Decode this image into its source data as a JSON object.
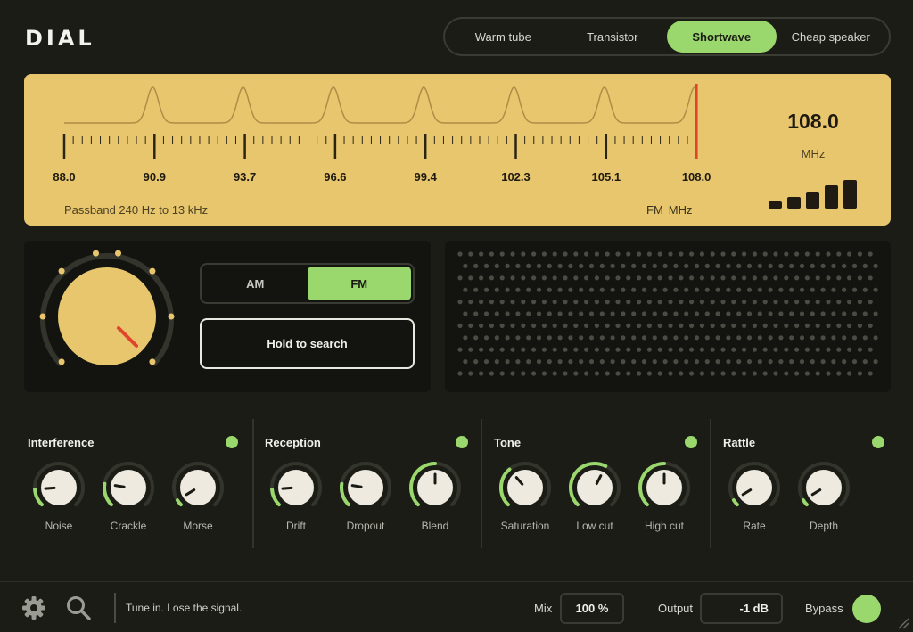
{
  "app": {
    "title": "DIAL"
  },
  "presets": {
    "items": [
      "Warm tube",
      "Transistor",
      "Shortwave",
      "Cheap speaker"
    ],
    "active_index": 2
  },
  "tuner": {
    "scale_labels": [
      "88.0",
      "90.9",
      "93.7",
      "96.6",
      "99.4",
      "102.3",
      "105.1",
      "108.0"
    ],
    "current_frequency": "108.0",
    "unit": "MHz",
    "passband_text": "Passband 240 Hz to 13 kHz",
    "band": "FM",
    "band_unit": "MHz",
    "signal_strength_bars": 5,
    "needle_color": "#e0452b"
  },
  "mode": {
    "options": [
      "AM",
      "FM"
    ],
    "selected": "FM"
  },
  "search_button": {
    "label": "Hold to search"
  },
  "sections": [
    {
      "title": "Interference",
      "enabled": true,
      "knobs": [
        {
          "label": "Noise",
          "value": 0.15
        },
        {
          "label": "Crackle",
          "value": 0.2
        },
        {
          "label": "Morse",
          "value": 0.05
        }
      ]
    },
    {
      "title": "Reception",
      "enabled": true,
      "knobs": [
        {
          "label": "Drift",
          "value": 0.15
        },
        {
          "label": "Dropout",
          "value": 0.2
        },
        {
          "label": "Blend",
          "value": 0.5
        }
      ]
    },
    {
      "title": "Tone",
      "enabled": true,
      "knobs": [
        {
          "label": "Saturation",
          "value": 0.35
        },
        {
          "label": "Low cut",
          "value": 0.6
        },
        {
          "label": "High cut",
          "value": 0.5
        }
      ]
    },
    {
      "title": "Rattle",
      "enabled": true,
      "knobs": [
        {
          "label": "Rate",
          "value": 0.05
        },
        {
          "label": "Depth",
          "value": 0.05
        }
      ]
    }
  ],
  "footer": {
    "status": "Tune in. Lose the signal.",
    "mix_label": "Mix",
    "mix_value": "100 %",
    "output_label": "Output",
    "output_value": "-1 dB",
    "bypass_label": "Bypass",
    "icons": [
      "gear-icon",
      "search-icon",
      "resize-grip-icon"
    ]
  },
  "colors": {
    "accent": "#9ad86e",
    "tuner_bg": "#e8c66d",
    "dial_face": "#e8c66d",
    "knob_face": "#eeeae0",
    "background": "#1b1c16"
  }
}
